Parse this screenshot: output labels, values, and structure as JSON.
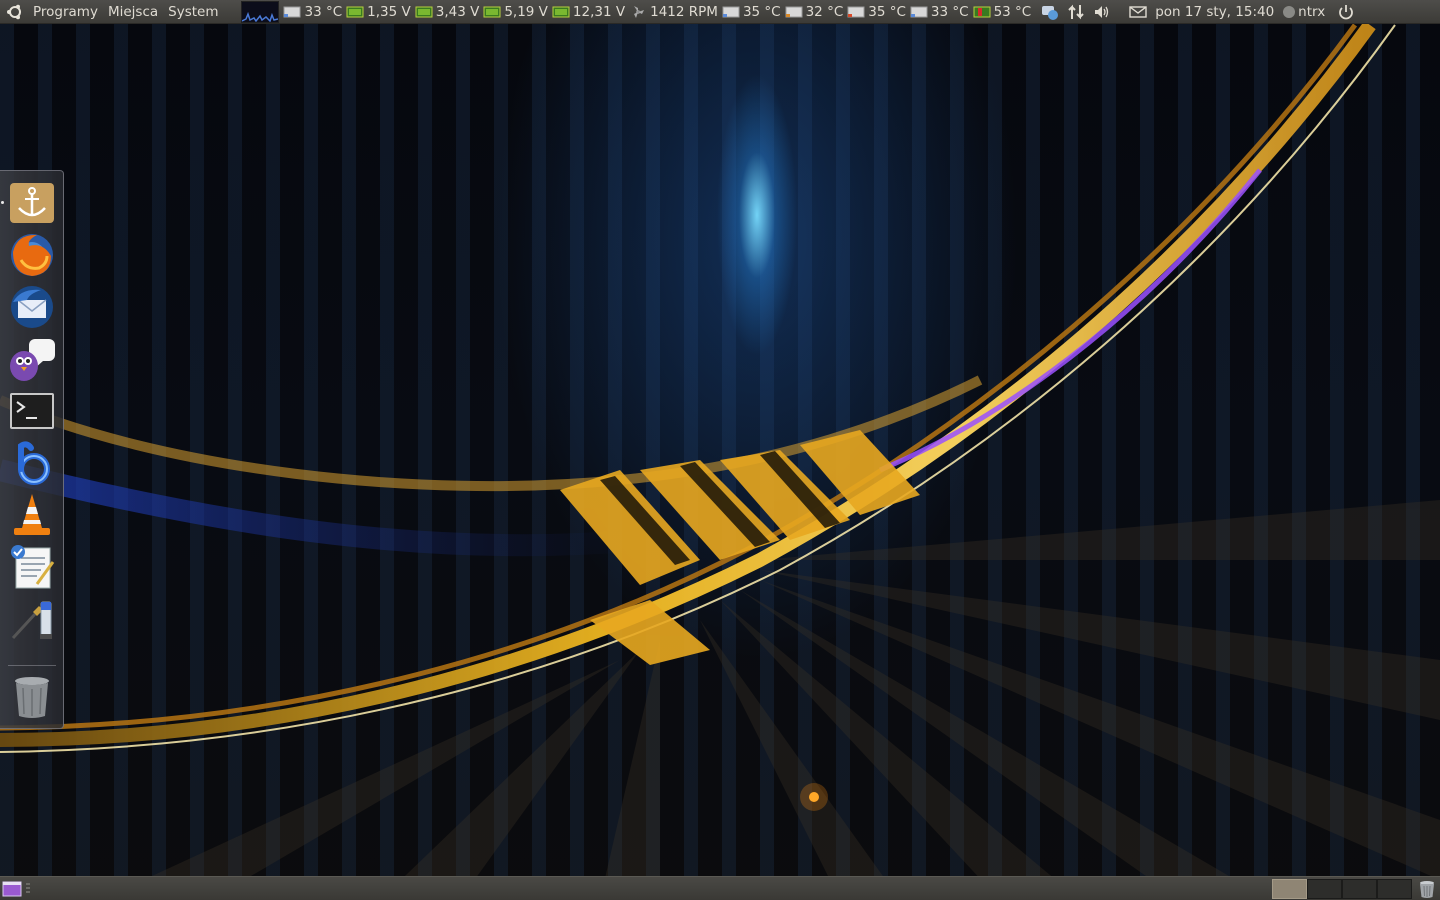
{
  "top_panel": {
    "menus": [
      "Programy",
      "Miejsca",
      "System"
    ],
    "sensors": [
      {
        "icon": "temperature-icon",
        "value": "33 °C"
      },
      {
        "icon": "voltage-icon",
        "value": "1,35 V"
      },
      {
        "icon": "voltage-icon",
        "value": "3,43 V"
      },
      {
        "icon": "voltage-icon",
        "value": "5,19 V"
      },
      {
        "icon": "voltage-icon",
        "value": "12,31 V"
      },
      {
        "icon": "fan-icon",
        "value": "1412 RPM"
      },
      {
        "icon": "temperature-icon",
        "value": "35 °C"
      },
      {
        "icon": "temperature-icon",
        "value": "32 °C"
      },
      {
        "icon": "temperature-icon",
        "value": "35 °C"
      },
      {
        "icon": "temperature-icon",
        "value": "33 °C"
      },
      {
        "icon": "hot-temperature-icon",
        "value": "53 °C"
      }
    ],
    "clock": "pon 17 sty, 15:40",
    "user": "ntrx",
    "tray_icons": [
      "chat-status-icon",
      "network-icon",
      "volume-icon",
      "mail-icon"
    ]
  },
  "dock": {
    "items": [
      {
        "name": "dock-item-docky",
        "icon": "anchor-icon"
      },
      {
        "name": "dock-item-firefox",
        "icon": "firefox-icon"
      },
      {
        "name": "dock-item-thunderbird",
        "icon": "thunderbird-icon"
      },
      {
        "name": "dock-item-pidgin",
        "icon": "pidgin-icon"
      },
      {
        "name": "dock-item-terminal",
        "icon": "terminal-icon"
      },
      {
        "name": "dock-item-banshee",
        "icon": "banshee-icon"
      },
      {
        "name": "dock-item-vlc",
        "icon": "vlc-icon"
      },
      {
        "name": "dock-item-text-editor",
        "icon": "text-editor-icon"
      },
      {
        "name": "dock-item-gimp",
        "icon": "gimp-icon"
      },
      {
        "name": "dock-item-trash",
        "icon": "trash-icon"
      }
    ]
  },
  "bottom_panel": {
    "workspaces": 4,
    "active_workspace": 1
  },
  "colors": {
    "panel": "#3c3b37",
    "panel_text": "#dfdbd2",
    "workspace_active": "#8f8574"
  }
}
